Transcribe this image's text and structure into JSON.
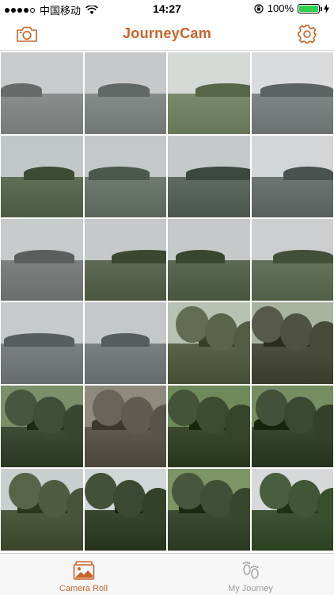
{
  "status_bar": {
    "carrier": "中国移动",
    "time": "14:27",
    "battery": "100%",
    "battery_level": 1.0
  },
  "navbar": {
    "title": "JourneyCam",
    "left_icon": "camera-icon",
    "right_icon": "gear-icon"
  },
  "photos": [
    {
      "name": "photo-lake-willow",
      "sky": "#c9cbcc",
      "water": "#8a8f8e"
    },
    {
      "name": "photo-lake-island",
      "sky": "#c6c8ca",
      "water": "#858b89"
    },
    {
      "name": "photo-parking-trees",
      "sky": "#d5d9d6",
      "water": "#7c8a6c"
    },
    {
      "name": "photo-lake-shore",
      "sky": "#d9dbdc",
      "water": "#7f8786"
    },
    {
      "name": "photo-lake-pagoda-hill",
      "sky": "#c2c7c7",
      "water": "#5f6f55"
    },
    {
      "name": "photo-lake-pagoda",
      "sky": "#c4c8c9",
      "water": "#6f7a70"
    },
    {
      "name": "photo-lake-hills",
      "sky": "#c5c9ca",
      "water": "#5f6a62"
    },
    {
      "name": "photo-causeway-people",
      "sky": "#d3d6d6",
      "water": "#6d7573"
    },
    {
      "name": "photo-lamp-post",
      "sky": "#c8cbcc",
      "water": "#7d8281"
    },
    {
      "name": "photo-lotus-1",
      "sky": "#c6c9ca",
      "water": "#5e6b52"
    },
    {
      "name": "photo-lotus-2",
      "sky": "#c6c9ca",
      "water": "#5c6a51"
    },
    {
      "name": "photo-lotus-3",
      "sky": "#cbcfcf",
      "water": "#66735b"
    },
    {
      "name": "photo-bench",
      "sky": "#c7cacb",
      "water": "#7b8080"
    },
    {
      "name": "photo-lake-pier",
      "sky": "#c5c8c9",
      "water": "#7a807f"
    },
    {
      "name": "photo-tree-path",
      "sky": "#b7c3b0",
      "water": "#5a6249"
    },
    {
      "name": "photo-stone-gate",
      "sky": "#a8b39e",
      "water": "#4d4f3f"
    },
    {
      "name": "photo-stone-archway",
      "sky": "#7b8f6a",
      "water": "#3e4b35"
    },
    {
      "name": "photo-temple-gate",
      "sky": "#8f8a7e",
      "water": "#5e5a50"
    },
    {
      "name": "photo-forest-steps",
      "sky": "#6f8a5a",
      "water": "#3b4a2f"
    },
    {
      "name": "photo-forest-stairs",
      "sky": "#758d60",
      "water": "#394630"
    },
    {
      "name": "photo-stone-pagoda",
      "sky": "#c9cfcf",
      "water": "#4d5a3e"
    },
    {
      "name": "photo-pagoda-closeup",
      "sky": "#d1d6d6",
      "water": "#3a4730"
    },
    {
      "name": "photo-forest-path",
      "sky": "#7d9466",
      "water": "#3e4c33"
    },
    {
      "name": "photo-lake-view",
      "sky": "#d6d9da",
      "water": "#3e5433"
    }
  ],
  "tabbar": {
    "tabs": [
      {
        "label": "Camera Roll",
        "icon": "photo-gallery-icon",
        "active": true
      },
      {
        "label": "My Journey",
        "icon": "footprints-icon",
        "active": false
      }
    ]
  },
  "colors": {
    "accent": "#c8642a",
    "inactive": "#9a9a9a"
  }
}
